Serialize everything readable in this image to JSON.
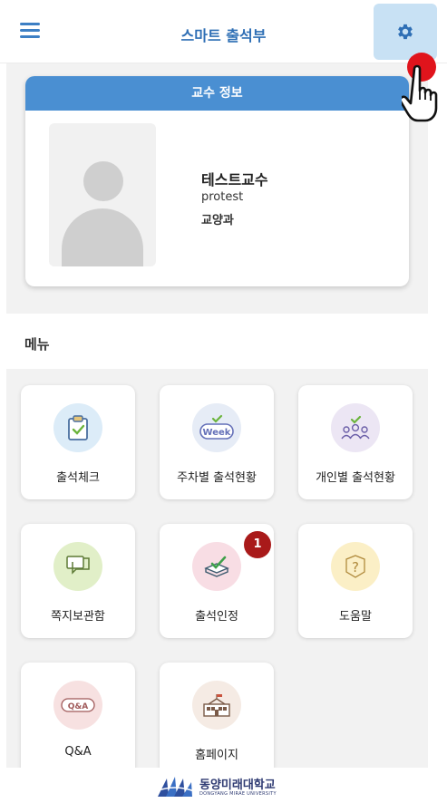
{
  "header": {
    "title": "스마트 출석부",
    "menu_icon": "hamburger-icon",
    "settings_icon": "gear-icon"
  },
  "profile": {
    "section_title": "교수 정보",
    "name": "테스트교수",
    "user_id": "protest",
    "department": "교양과"
  },
  "menu": {
    "heading": "메뉴",
    "items": [
      {
        "label": "출석체크",
        "icon": "clipboard-check-icon",
        "color": "#dcecf8"
      },
      {
        "label": "주차별 출석현황",
        "icon": "week-icon",
        "color": "#e6ecf6"
      },
      {
        "label": "개인별 출석현황",
        "icon": "people-check-icon",
        "color": "#ece6f4"
      },
      {
        "label": "쪽지보관함",
        "icon": "message-icon",
        "color": "#e1efc8"
      },
      {
        "label": "출석인정",
        "icon": "book-check-icon",
        "color": "#f8dde4",
        "badge": "1"
      },
      {
        "label": "도움말",
        "icon": "question-icon",
        "color": "#fbefc6"
      },
      {
        "label": "Q&A",
        "icon": "qa-icon",
        "color": "#f7e1e1"
      },
      {
        "label": "홈페이지",
        "icon": "school-building-icon",
        "color": "#f5ebe4"
      }
    ]
  },
  "footer": {
    "logo_text": "동양미래대학교",
    "logo_subtext": "DONGYANG MIRAE UNIVERSITY"
  },
  "colors": {
    "primary": "#2f6fb5",
    "profile_header": "#4a8fd2",
    "badge": "#a91a1a",
    "tap_indicator": "#e0141c"
  }
}
